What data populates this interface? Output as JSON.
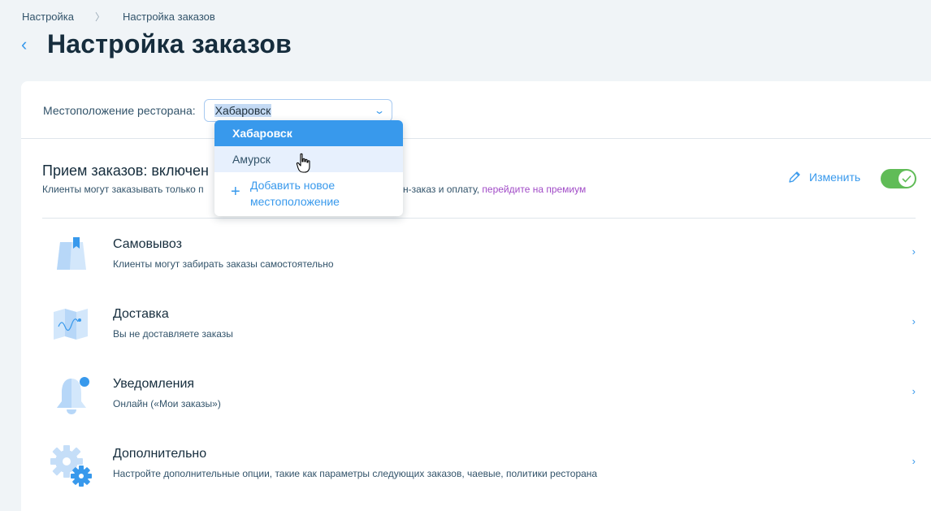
{
  "breadcrumb": {
    "root": "Настройка",
    "current": "Настройка заказов"
  },
  "header": {
    "title": "Настройка заказов"
  },
  "location": {
    "label": "Местоположение ресторана:",
    "selected": "Хабаровск",
    "options": [
      "Хабаровск",
      "Амурск"
    ],
    "add_line1": "Добавить новое",
    "add_line2": "местоположение"
  },
  "accept": {
    "title": "Прием заказов: включен",
    "desc_start": "Клиенты могут заказывать только п",
    "desc_end": "н-заказ и оплату, ",
    "premium_link": "перейдите на премиум",
    "edit_label": "Изменить",
    "enabled": true
  },
  "items": [
    {
      "name": "Самовывоз",
      "desc": "Клиенты могут забирать заказы самостоятельно",
      "icon": "bag-icon"
    },
    {
      "name": "Доставка",
      "desc": "Вы не доставляете заказы",
      "icon": "map-icon"
    },
    {
      "name": "Уведомления",
      "desc": "Онлайн («Мои заказы»)",
      "icon": "bell-icon"
    },
    {
      "name": "Дополнительно",
      "desc": "Настройте дополнительные опции, такие как параметры следующих заказов, чаевые, политики ресторана",
      "icon": "gear-icon"
    }
  ],
  "colors": {
    "accent": "#3899ec",
    "toggle_on": "#60bc57",
    "premium": "#a14bc7",
    "title": "#162d3d"
  }
}
